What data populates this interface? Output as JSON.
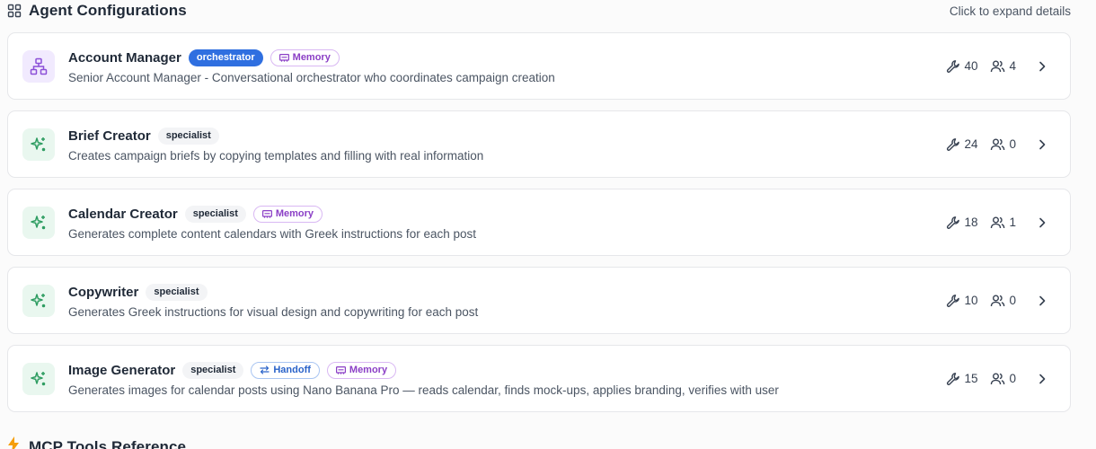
{
  "header": {
    "title": "Agent Configurations",
    "hint": "Click to expand details"
  },
  "agents": [
    {
      "name": "Account Manager",
      "role": "orchestrator",
      "tags": [
        "Memory"
      ],
      "description": "Senior Account Manager - Conversational orchestrator who coordinates campaign creation",
      "tools": "40",
      "users": "4"
    },
    {
      "name": "Brief Creator",
      "role": "specialist",
      "tags": [],
      "description": "Creates campaign briefs by copying templates and filling with real information",
      "tools": "24",
      "users": "0"
    },
    {
      "name": "Calendar Creator",
      "role": "specialist",
      "tags": [
        "Memory"
      ],
      "description": "Generates complete content calendars with Greek instructions for each post",
      "tools": "18",
      "users": "1"
    },
    {
      "name": "Copywriter",
      "role": "specialist",
      "tags": [],
      "description": "Generates Greek instructions for visual design and copywriting for each post",
      "tools": "10",
      "users": "0"
    },
    {
      "name": "Image Generator",
      "role": "specialist",
      "tags": [
        "Handoff",
        "Memory"
      ],
      "description": "Generates images for calendar posts using Nano Banana Pro — reads calendar, finds mock-ups, applies branding, verifies with user",
      "tools": "15",
      "users": "0"
    }
  ],
  "next_section": {
    "title": "MCP Tools Reference"
  },
  "colors": {
    "orchestrator_badge": "#2f6fe0",
    "memory_tag": "#8b3fc6",
    "handoff_tag": "#2a63c9",
    "orchestrator_icon": "#8b4fd8",
    "specialist_icon": "#2f9d62",
    "section_icon": "#f59e0b"
  },
  "icons": {
    "header": "grid-icon",
    "orchestrator": "hierarchy-icon",
    "specialist": "sparkles-icon",
    "tools": "wrench-icon",
    "users": "users-icon",
    "expand": "chevron-right-icon",
    "memory": "memory-chip-icon",
    "handoff": "arrows-swap-icon",
    "next_section": "lightning-icon"
  }
}
